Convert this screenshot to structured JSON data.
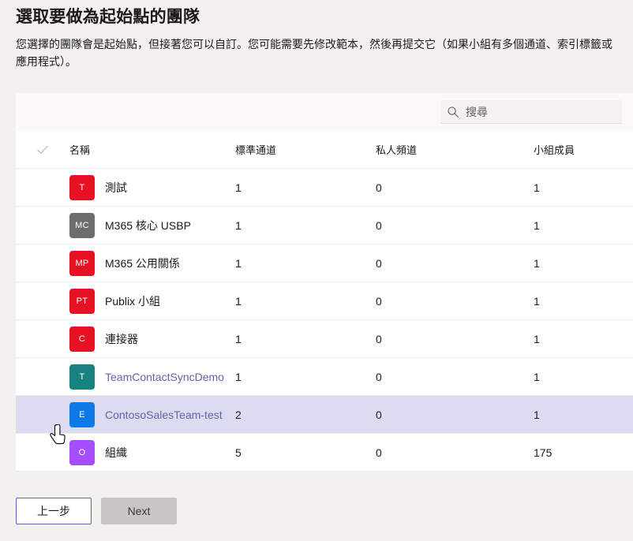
{
  "page": {
    "title": "選取要做為起始點的團隊",
    "description": "您選擇的團隊會是起始點，但接著您可以自訂。您可能需要先修改範本，然後再提交它（如果小組有多個通道、索引標籤或應用程式）。"
  },
  "search": {
    "placeholder": "搜尋",
    "value": "",
    "icon": "search-icon"
  },
  "table": {
    "select_all_icon": "checkmark-icon",
    "columns": {
      "name": "名稱",
      "standard_channels": "標準通道",
      "private_channels": "私人頻道",
      "members": "小組成員"
    },
    "rows": [
      {
        "initials": "T",
        "color": "#e81123",
        "name": "測試",
        "link": false,
        "standard": "1",
        "private": "0",
        "members": "1",
        "selected": false
      },
      {
        "initials": "MC",
        "color": "#6d6d6d",
        "name": "M365 核心 USBP",
        "link": false,
        "standard": "1",
        "private": "0",
        "members": "1",
        "selected": false
      },
      {
        "initials": "MP",
        "color": "#e81123",
        "name": "M365 公用關係",
        "link": false,
        "standard": "1",
        "private": "0",
        "members": "1",
        "selected": false
      },
      {
        "initials": "PT",
        "color": "#e81123",
        "name": "Publix 小組",
        "link": false,
        "standard": "1",
        "private": "0",
        "members": "1",
        "selected": false
      },
      {
        "initials": "C",
        "color": "#e81123",
        "name": "連接器",
        "link": false,
        "standard": "1",
        "private": "0",
        "members": "1",
        "selected": false
      },
      {
        "initials": "T",
        "color": "#18837e",
        "name": "TeamContactSyncDemo",
        "link": true,
        "standard": "1",
        "private": "0",
        "members": "1",
        "selected": false
      },
      {
        "initials": "E",
        "color": "#0f7ae5",
        "name": "ContosoSalesTeam-test",
        "link": true,
        "standard": "2",
        "private": "0",
        "members": "1",
        "selected": true
      },
      {
        "initials": "O",
        "color": "#a64dff",
        "name": "組織",
        "link": false,
        "standard": "5",
        "private": "0",
        "members": "175",
        "selected": false
      }
    ]
  },
  "footer": {
    "back_label": "上一步",
    "next_label": "Next"
  },
  "colors": {
    "accent": "#6264a7",
    "selected_row": "#dcdcf0",
    "page_background": "#f2f1f0"
  }
}
